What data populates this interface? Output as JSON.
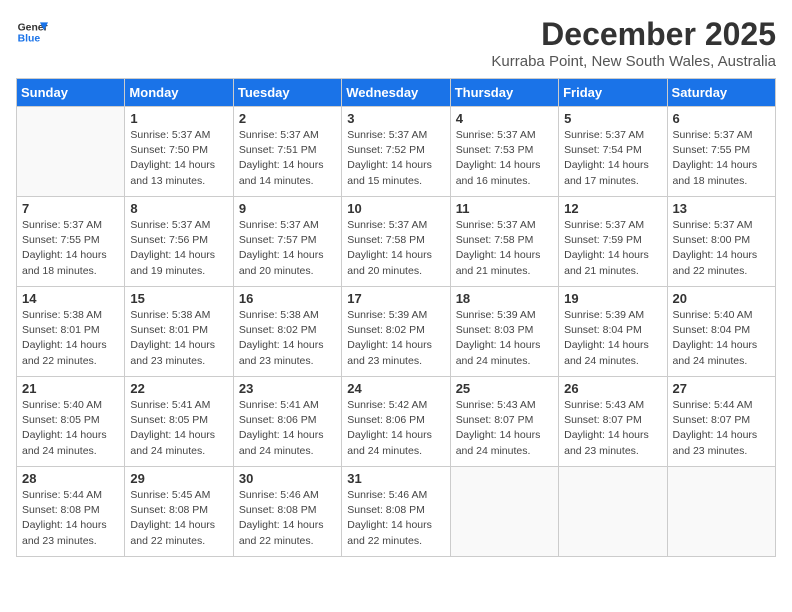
{
  "logo": {
    "line1": "General",
    "line2": "Blue"
  },
  "title": "December 2025",
  "location": "Kurraba Point, New South Wales, Australia",
  "days_of_week": [
    "Sunday",
    "Monday",
    "Tuesday",
    "Wednesday",
    "Thursday",
    "Friday",
    "Saturday"
  ],
  "weeks": [
    [
      {
        "day": "",
        "info": ""
      },
      {
        "day": "1",
        "info": "Sunrise: 5:37 AM\nSunset: 7:50 PM\nDaylight: 14 hours\nand 13 minutes."
      },
      {
        "day": "2",
        "info": "Sunrise: 5:37 AM\nSunset: 7:51 PM\nDaylight: 14 hours\nand 14 minutes."
      },
      {
        "day": "3",
        "info": "Sunrise: 5:37 AM\nSunset: 7:52 PM\nDaylight: 14 hours\nand 15 minutes."
      },
      {
        "day": "4",
        "info": "Sunrise: 5:37 AM\nSunset: 7:53 PM\nDaylight: 14 hours\nand 16 minutes."
      },
      {
        "day": "5",
        "info": "Sunrise: 5:37 AM\nSunset: 7:54 PM\nDaylight: 14 hours\nand 17 minutes."
      },
      {
        "day": "6",
        "info": "Sunrise: 5:37 AM\nSunset: 7:55 PM\nDaylight: 14 hours\nand 18 minutes."
      }
    ],
    [
      {
        "day": "7",
        "info": "Sunrise: 5:37 AM\nSunset: 7:55 PM\nDaylight: 14 hours\nand 18 minutes."
      },
      {
        "day": "8",
        "info": "Sunrise: 5:37 AM\nSunset: 7:56 PM\nDaylight: 14 hours\nand 19 minutes."
      },
      {
        "day": "9",
        "info": "Sunrise: 5:37 AM\nSunset: 7:57 PM\nDaylight: 14 hours\nand 20 minutes."
      },
      {
        "day": "10",
        "info": "Sunrise: 5:37 AM\nSunset: 7:58 PM\nDaylight: 14 hours\nand 20 minutes."
      },
      {
        "day": "11",
        "info": "Sunrise: 5:37 AM\nSunset: 7:58 PM\nDaylight: 14 hours\nand 21 minutes."
      },
      {
        "day": "12",
        "info": "Sunrise: 5:37 AM\nSunset: 7:59 PM\nDaylight: 14 hours\nand 21 minutes."
      },
      {
        "day": "13",
        "info": "Sunrise: 5:37 AM\nSunset: 8:00 PM\nDaylight: 14 hours\nand 22 minutes."
      }
    ],
    [
      {
        "day": "14",
        "info": "Sunrise: 5:38 AM\nSunset: 8:01 PM\nDaylight: 14 hours\nand 22 minutes."
      },
      {
        "day": "15",
        "info": "Sunrise: 5:38 AM\nSunset: 8:01 PM\nDaylight: 14 hours\nand 23 minutes."
      },
      {
        "day": "16",
        "info": "Sunrise: 5:38 AM\nSunset: 8:02 PM\nDaylight: 14 hours\nand 23 minutes."
      },
      {
        "day": "17",
        "info": "Sunrise: 5:39 AM\nSunset: 8:02 PM\nDaylight: 14 hours\nand 23 minutes."
      },
      {
        "day": "18",
        "info": "Sunrise: 5:39 AM\nSunset: 8:03 PM\nDaylight: 14 hours\nand 24 minutes."
      },
      {
        "day": "19",
        "info": "Sunrise: 5:39 AM\nSunset: 8:04 PM\nDaylight: 14 hours\nand 24 minutes."
      },
      {
        "day": "20",
        "info": "Sunrise: 5:40 AM\nSunset: 8:04 PM\nDaylight: 14 hours\nand 24 minutes."
      }
    ],
    [
      {
        "day": "21",
        "info": "Sunrise: 5:40 AM\nSunset: 8:05 PM\nDaylight: 14 hours\nand 24 minutes."
      },
      {
        "day": "22",
        "info": "Sunrise: 5:41 AM\nSunset: 8:05 PM\nDaylight: 14 hours\nand 24 minutes."
      },
      {
        "day": "23",
        "info": "Sunrise: 5:41 AM\nSunset: 8:06 PM\nDaylight: 14 hours\nand 24 minutes."
      },
      {
        "day": "24",
        "info": "Sunrise: 5:42 AM\nSunset: 8:06 PM\nDaylight: 14 hours\nand 24 minutes."
      },
      {
        "day": "25",
        "info": "Sunrise: 5:43 AM\nSunset: 8:07 PM\nDaylight: 14 hours\nand 24 minutes."
      },
      {
        "day": "26",
        "info": "Sunrise: 5:43 AM\nSunset: 8:07 PM\nDaylight: 14 hours\nand 23 minutes."
      },
      {
        "day": "27",
        "info": "Sunrise: 5:44 AM\nSunset: 8:07 PM\nDaylight: 14 hours\nand 23 minutes."
      }
    ],
    [
      {
        "day": "28",
        "info": "Sunrise: 5:44 AM\nSunset: 8:08 PM\nDaylight: 14 hours\nand 23 minutes."
      },
      {
        "day": "29",
        "info": "Sunrise: 5:45 AM\nSunset: 8:08 PM\nDaylight: 14 hours\nand 22 minutes."
      },
      {
        "day": "30",
        "info": "Sunrise: 5:46 AM\nSunset: 8:08 PM\nDaylight: 14 hours\nand 22 minutes."
      },
      {
        "day": "31",
        "info": "Sunrise: 5:46 AM\nSunset: 8:08 PM\nDaylight: 14 hours\nand 22 minutes."
      },
      {
        "day": "",
        "info": ""
      },
      {
        "day": "",
        "info": ""
      },
      {
        "day": "",
        "info": ""
      }
    ]
  ]
}
